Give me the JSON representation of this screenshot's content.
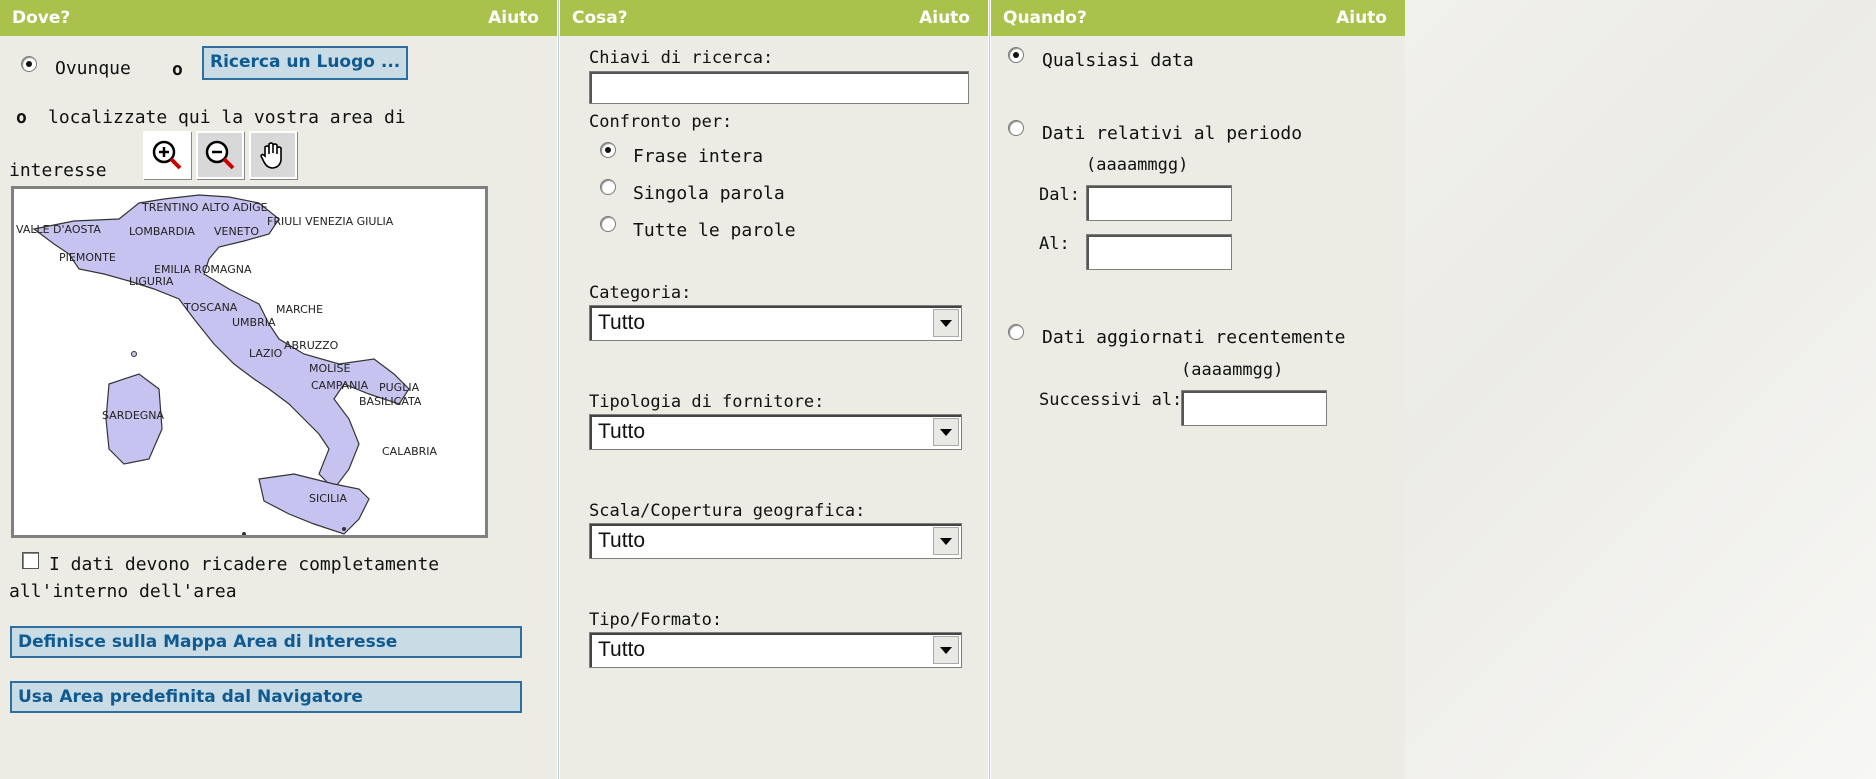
{
  "where": {
    "title": "Dove?",
    "help": "Aiuto",
    "anywhere_label": "Ovunque",
    "or1": "o",
    "search_place_button": "Ricerca un Luogo ...",
    "or2": "o",
    "locate_text_1": "localizzate qui la vostra area di",
    "locate_text_2": "interesse",
    "tools": [
      "zoom-in-icon",
      "zoom-out-icon",
      "pan-hand-icon"
    ],
    "map_regions": [
      "TRENTINO ALTO ADIGE",
      "FRIULI VENEZIA GIULIA",
      "VALLE D'AOSTA",
      "LOMBARDIA",
      "VENETO",
      "PIEMONTE",
      "EMILIA ROMAGNA",
      "LIGURIA",
      "TOSCANA",
      "MARCHE",
      "UMBRIA",
      "ABRUZZO",
      "LAZIO",
      "MOLISE",
      "CAMPANIA",
      "PUGLIA",
      "BASILICATA",
      "SARDEGNA",
      "CALABRIA",
      "SICILIA"
    ],
    "contain_text_1": "I dati devono ricadere completamente",
    "contain_text_2": "all'interno dell'area",
    "define_area_button": "Definisce sulla Mappa Area di Interesse",
    "use_area_button": "Usa Area predefinita dal Navigatore"
  },
  "what": {
    "title": "Cosa?",
    "help": "Aiuto",
    "keywords_label": "Chiavi di ricerca:",
    "keywords_value": "",
    "match_label": "Confronto per:",
    "match_options": [
      "Frase intera",
      "Singola parola",
      "Tutte le parole"
    ],
    "category_label": "Categoria:",
    "category_value": "Tutto",
    "provider_label": "Tipologia di fornitore:",
    "provider_value": "Tutto",
    "scale_label": "Scala/Copertura geografica:",
    "scale_value": "Tutto",
    "format_label": "Tipo/Formato:",
    "format_value": "Tutto"
  },
  "when": {
    "title": "Quando?",
    "help": "Aiuto",
    "any_date": "Qualsiasi data",
    "period_label": "Dati relativi al periodo",
    "period_format": "(aaaammgg)",
    "from_label": "Dal:",
    "to_label": "Al:",
    "recent_label": "Dati aggiornati recentemente",
    "recent_format": "(aaaammgg)",
    "after_label": "Successivi al:"
  },
  "colors": {
    "header_green": "#a8c24c",
    "panel_bg": "#ecece4",
    "link_blue": "#0f5b91",
    "map_land": "#c7c3f0"
  }
}
